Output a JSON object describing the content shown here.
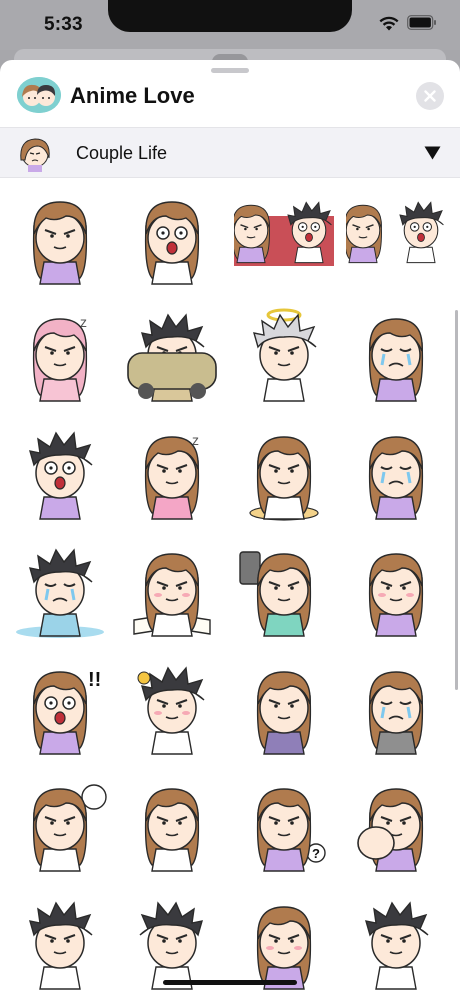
{
  "status_bar": {
    "time": "5:33"
  },
  "header": {
    "title": "Anime Love"
  },
  "pack_selector": {
    "name": "Couple Life"
  },
  "stickers": {
    "rows": 7,
    "cols": 4,
    "items": [
      {
        "hair": "brown",
        "shirt": "#c9a9e8",
        "mood": "annoyed"
      },
      {
        "hair": "brown",
        "shirt": "#ffffff",
        "mood": "shocked"
      },
      {
        "hair": "mixed",
        "shirt": "#c9a9e8",
        "mood": "couple",
        "bg": "#c0303a"
      },
      {
        "hair": "mixed",
        "shirt": "#c9a9e8",
        "mood": "couple"
      },
      {
        "hair": "pink",
        "shirt": "#f7c4d4",
        "mood": "sleeping"
      },
      {
        "hair": "dark",
        "shirt": "#d9c79a",
        "mood": "car",
        "bg": "#c9bd8f"
      },
      {
        "hair": "silver",
        "shirt": "#ffffff",
        "mood": "angel",
        "bg": "#f2ee9a"
      },
      {
        "hair": "brown",
        "shirt": "#c9a9e8",
        "mood": "crying"
      },
      {
        "hair": "dark",
        "shirt": "#c9a9e8",
        "mood": "shouting"
      },
      {
        "hair": "brown",
        "shirt": "#f4a6c6",
        "mood": "sleeping"
      },
      {
        "hair": "brown",
        "shirt": "#ffffff",
        "mood": "eating",
        "bg": "#f3d28a"
      },
      {
        "hair": "brown",
        "shirt": "#c9a9e8",
        "mood": "crying"
      },
      {
        "hair": "dark",
        "shirt": "#9bd3e8",
        "mood": "sad",
        "bg": "#a9dcef"
      },
      {
        "hair": "brown",
        "shirt": "#ffffff",
        "mood": "reading",
        "bg": "#e7dcc8"
      },
      {
        "hair": "brown",
        "shirt": "#7fd5c0",
        "mood": "selfie"
      },
      {
        "hair": "brown",
        "shirt": "#c9a9e8",
        "mood": "blush"
      },
      {
        "hair": "brown",
        "shirt": "#c9a9e8",
        "mood": "surprised"
      },
      {
        "hair": "dark",
        "shirt": "#ffffff",
        "mood": "flower"
      },
      {
        "hair": "brown",
        "shirt": "#8f7fb8",
        "mood": "angry"
      },
      {
        "hair": "brown",
        "shirt": "#8f8f8f",
        "mood": "tired"
      },
      {
        "hair": "brown",
        "shirt": "#ffffff",
        "mood": "thinking"
      },
      {
        "hair": "brown",
        "shirt": "#ffffff",
        "mood": "running"
      },
      {
        "hair": "brown",
        "shirt": "#c9a9e8",
        "mood": "question"
      },
      {
        "hair": "brown",
        "shirt": "#c9a9e8",
        "mood": "punch"
      },
      {
        "hair": "dark",
        "shirt": "#ffffff",
        "mood": "nervous"
      },
      {
        "hair": "dark",
        "shirt": "#ffffff",
        "mood": "waving"
      },
      {
        "hair": "brown",
        "shirt": "#c9a9e8",
        "mood": "blush"
      },
      {
        "hair": "dark",
        "shirt": "#ffffff",
        "mood": "shrug"
      }
    ]
  },
  "colors": {
    "skin": "#fde9d9",
    "hair_brown": "#b07b4e",
    "hair_dark": "#3a3a3e",
    "hair_pink": "#f2b2c6",
    "hair_silver": "#d8d8dc",
    "outline": "#2a2a2a",
    "accent": "#e2e2e6"
  },
  "icons": {
    "wifi": "wifi-icon",
    "battery": "battery-icon",
    "close": "close-icon",
    "chevron": "chevron-down-icon"
  }
}
